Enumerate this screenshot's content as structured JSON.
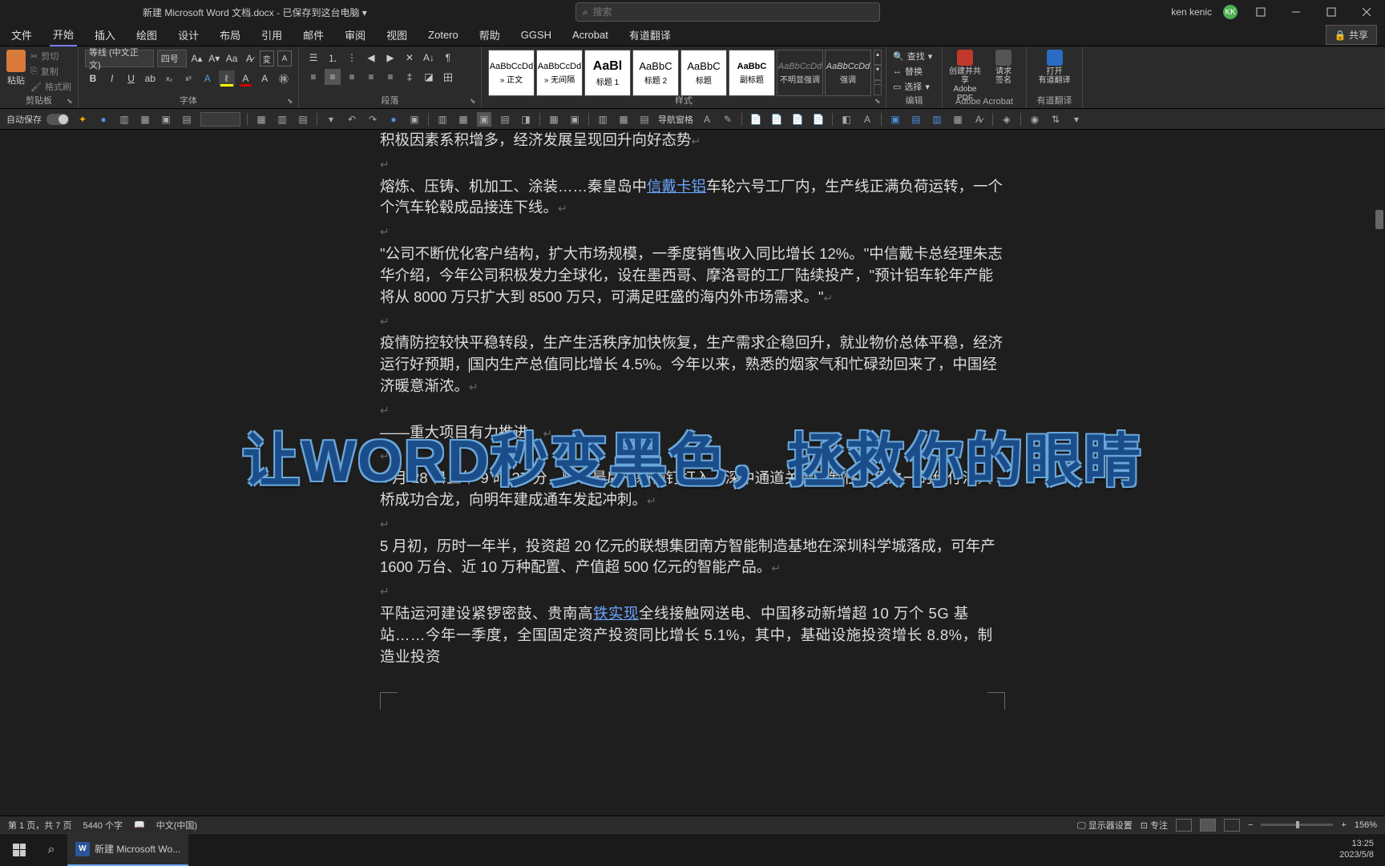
{
  "title_bar": {
    "doc_title": "新建 Microsoft Word 文档.docx - 已保存到这台电脑 ▾",
    "search_placeholder": "搜索",
    "user_name": "ken kenic",
    "user_initials": "KK"
  },
  "menu": {
    "items": [
      "文件",
      "开始",
      "插入",
      "绘图",
      "设计",
      "布局",
      "引用",
      "邮件",
      "审阅",
      "视图",
      "Zotero",
      "帮助",
      "GGSH",
      "Acrobat",
      "有道翻译"
    ],
    "active_index": 1,
    "share": "共享"
  },
  "ribbon": {
    "clipboard": {
      "paste": "粘贴",
      "cut": "剪切",
      "copy": "复制",
      "format_painter": "格式刷",
      "label": "剪贴板"
    },
    "font": {
      "name": "等线 (中文正文)",
      "size": "四号",
      "label": "字体"
    },
    "paragraph": {
      "label": "段落"
    },
    "styles": {
      "items": [
        {
          "preview": "AaBbCcDd",
          "name": "» 正文",
          "light": true
        },
        {
          "preview": "AaBbCcDd",
          "name": "» 无间隔",
          "light": true
        },
        {
          "preview": "AaBl",
          "name": "标题 1",
          "light": true,
          "big": true
        },
        {
          "preview": "AaBbC",
          "name": "标题 2",
          "light": true
        },
        {
          "preview": "AaBbC",
          "name": "标题",
          "light": true
        },
        {
          "preview": "AaBbC",
          "name": "副标题",
          "light": true,
          "bold": true
        },
        {
          "preview": "AaBbCcDd",
          "name": "不明显强调",
          "dark": true
        },
        {
          "preview": "AaBbCcDd",
          "name": "强调",
          "dark": true
        }
      ],
      "label": "样式"
    },
    "editing": {
      "find": "查找",
      "replace": "替换",
      "select": "选择",
      "label": "编辑"
    },
    "adobe": {
      "create": "创建并共享\nAdobe PDF",
      "sign": "请求\n签名",
      "label": "Adobe Acrobat"
    },
    "youdao": {
      "open": "打开\n有道翻译",
      "label": "有道翻译"
    }
  },
  "quick_bar": {
    "autosave": "自动保存",
    "nav_pane": "导航窗格"
  },
  "document": {
    "p1": "积极因素系积增多，经济发展呈现回升向好态势",
    "p2a": "熔炼、压铸、机加工、涂装……秦皇岛中",
    "p2b": "信戴卡铝",
    "p2c": "车轮六号工厂内，生产线正满负荷运转，一个个汽车轮毂成品接连下线。",
    "p3": "\"公司不断优化客户结构，扩大市场规模，一季度销售收入同比增长 12%。\"中信戴卡总经理朱志华介绍，今年公司积极发力全球化，设在墨西哥、摩洛哥的工厂陆续投产，\"预计铝车轮年产能将从 8000 万只扩大到 8500 万只，可满足旺盛的海内外市场需求。\"",
    "p4a": "疫情防控较快平稳转段，生产生活秩序加快恢复，生产需求企稳回升，就业物价总体平稳，经济运行好预期，",
    "p4b": "国内生产总值同比增长 4.5%。今年以来，熟悉的烟家气和忙碌劲回来了，中国经济暖意渐浓。",
    "p5": "——重大项目有力推进。",
    "p6": "4 月 28 日上午 9 时 37 分，随着最后一颗销钉打入，深中通道关键控制性工程之一的伶仃洋大桥成功合龙，向明年建成通车发起冲刺。",
    "p7": "5 月初，历时一年半，投资超 20 亿元的联想集团南方智能制造基地在深圳科学城落成，可年产 1600 万台、近 10 万种配置、产值超 500 亿元的智能产品。",
    "p8a": "平陆运河建设紧锣密鼓、贵南高",
    "p8b": "铁实现",
    "p8c": "全线接触网送电、中国移动新增超 10 万个 5G 基站……今年一季度，全国固定资产投资同比增长 5.1%，其中，基础设施投资增长 8.8%，制造业投资"
  },
  "overlay": "让WORD秒变黑色，拯救你的眼睛",
  "status": {
    "page": "第 1 页，共 7 页",
    "words": "5440 个字",
    "lang": "中文(中国)",
    "display": "显示器设置",
    "focus": "专注",
    "zoom": "156%"
  },
  "taskbar": {
    "item": "新建 Microsoft Wo...",
    "time": "13:25",
    "date": "2023/5/8"
  }
}
